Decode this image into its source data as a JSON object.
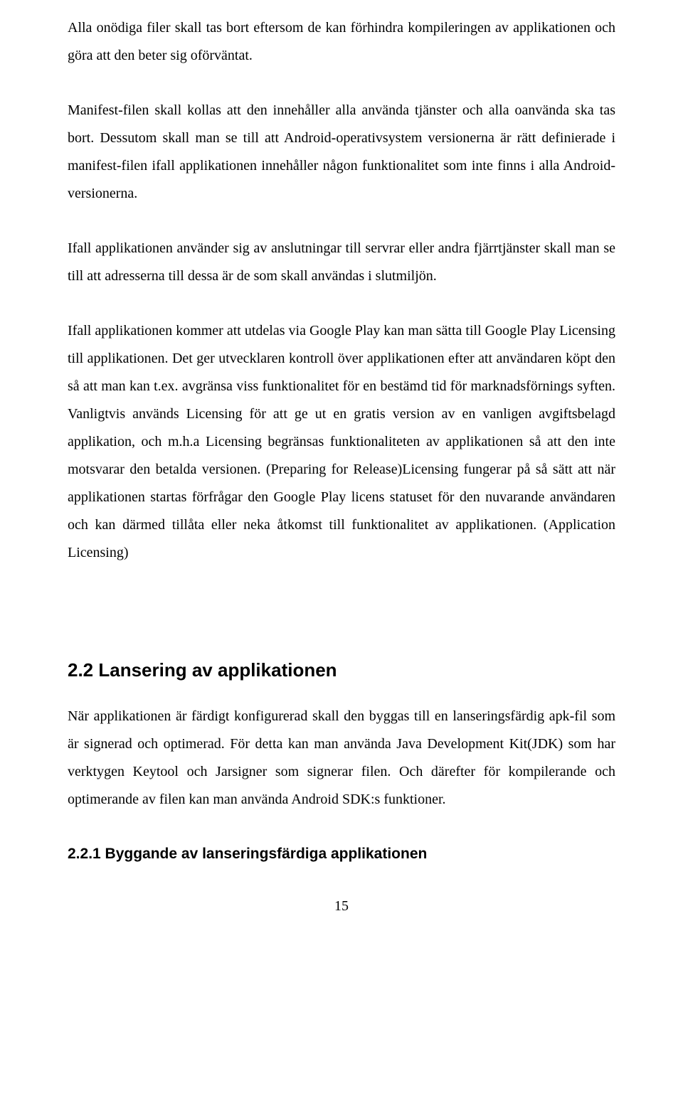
{
  "paragraphs": {
    "p1": "Alla onödiga filer skall tas bort eftersom de kan förhindra kompileringen av applikationen och göra att den beter sig oförväntat.",
    "p2": "Manifest-filen skall kollas att den innehåller alla använda tjänster och alla oanvända ska tas bort. Dessutom skall man se till att Android-operativsystem versionerna är rätt definierade i manifest-filen ifall applikationen innehåller någon funktionalitet som inte finns i alla Android-versionerna.",
    "p3": "Ifall applikationen använder sig av anslutningar till servrar eller andra fjärrtjänster skall man se till att adresserna till dessa är de som skall användas i slutmiljön.",
    "p4": "Ifall applikationen kommer att utdelas via Google Play kan man sätta till Google Play Licensing till applikationen. Det ger utvecklaren kontroll över applikationen efter att användaren köpt den så att man kan t.ex. avgränsa viss funktionalitet för en bestämd tid för marknadsförnings syften. Vanligtvis används Licensing för att ge ut en gratis version av en vanligen avgiftsbelagd applikation, och m.h.a Licensing begränsas funktionaliteten av applikationen så att den inte motsvarar den betalda versionen. (Preparing for Release)Licensing fungerar på så sätt att när applikationen startas förfrågar den Google Play licens statuset för den nuvarande användaren och kan därmed tillåta eller neka åtkomst till funktionalitet av applikationen. (Application Licensing)"
  },
  "headings": {
    "h2": "2.2  Lansering av applikationen",
    "h3": "2.2.1  Byggande av lanseringsfärdiga applikationen"
  },
  "section2_2": {
    "p1": "När applikationen är färdigt konfigurerad skall den byggas till en lanseringsfärdig apk-fil som är signerad och optimerad. För detta kan man använda Java Development Kit(JDK) som har verktygen Keytool och Jarsigner som signerar filen. Och därefter för kompilerande och optimerande av filen kan man använda Android SDK:s funktioner."
  },
  "page_number": "15"
}
